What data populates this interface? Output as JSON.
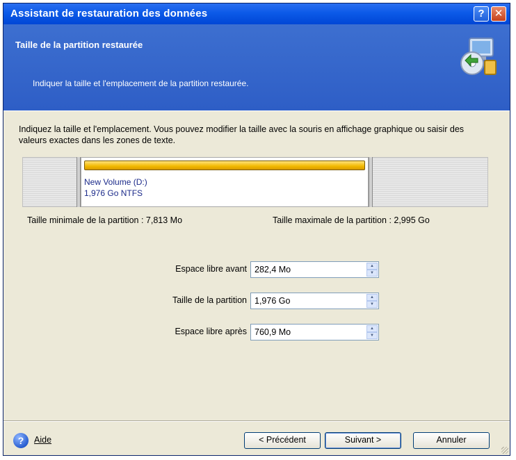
{
  "window": {
    "title": "Assistant de restauration des données",
    "help_button": "?",
    "close_button": "✕"
  },
  "header": {
    "title": "Taille de la partition restaurée",
    "subtitle": "Indiquer la taille et l'emplacement de la partition restaurée."
  },
  "body": {
    "intro": "Indiquez la taille et l'emplacement. Vous pouvez modifier la taille avec la souris en affichage graphique ou saisir des valeurs exactes dans les zones de texte.",
    "partition": {
      "name": "New Volume (D:)",
      "info": "1,976 Go  NTFS"
    },
    "min_size": "Taille minimale de la partition :  7,813 Mo",
    "max_size": "Taille maximale de la partition :  2,995 Go",
    "fields": [
      {
        "label": "Espace libre avant",
        "value": "282,4 Mo"
      },
      {
        "label": "Taille de la partition",
        "value": "1,976 Go"
      },
      {
        "label": "Espace libre après",
        "value": "760,9 Mo"
      }
    ]
  },
  "footer": {
    "help": "Aide",
    "prev": "< Précédent",
    "next": "Suivant >",
    "cancel": "Annuler"
  },
  "colors": {
    "title_bar": "#0c5ae8",
    "header_band": "#2e5ec6",
    "partition_bar": "#f2b900",
    "dialog_bg": "#ece9d8"
  },
  "icons": {
    "help_icon": "question-circle",
    "logo_icon": "restore-computer-icon"
  }
}
